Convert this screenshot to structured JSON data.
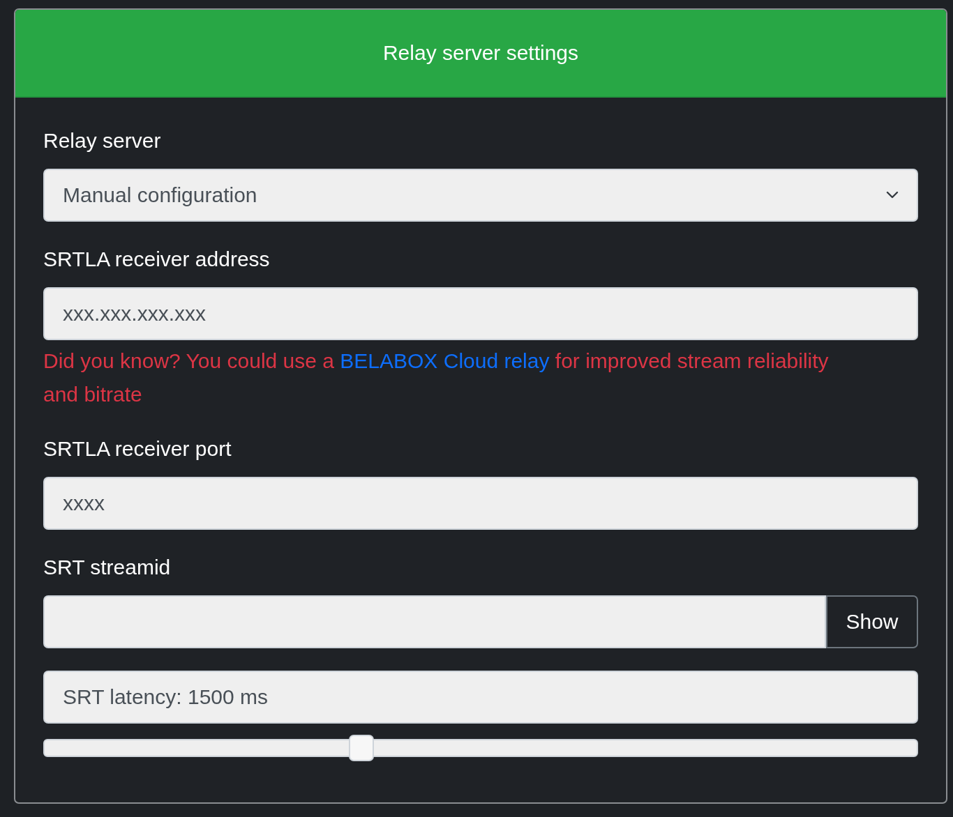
{
  "card": {
    "title": "Relay server settings"
  },
  "relay_server": {
    "label": "Relay server",
    "value": "Manual configuration"
  },
  "address": {
    "label": "SRTLA receiver address",
    "placeholder": "xxx.xxx.xxx.xxx"
  },
  "hint": {
    "before": "Did you know? You could use a ",
    "link": "BELABOX Cloud relay",
    "after": " for improved stream reliability and bitrate"
  },
  "port": {
    "label": "SRTLA receiver port",
    "placeholder": "xxxx"
  },
  "streamid": {
    "label": "SRT streamid",
    "button": "Show"
  },
  "latency": {
    "value": "SRT latency: 1500 ms",
    "level": 0.36
  }
}
